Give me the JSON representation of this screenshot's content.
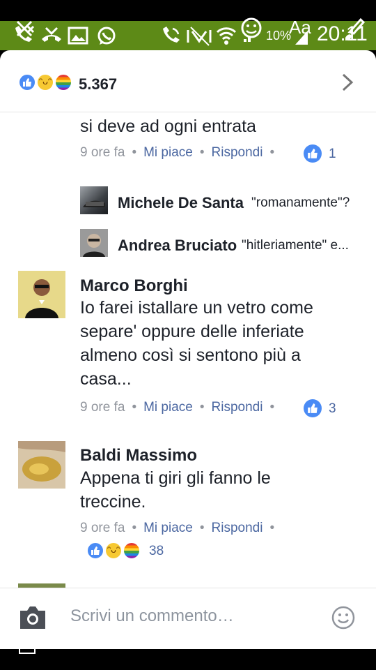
{
  "status_bar": {
    "time": "20:11",
    "battery": "10%",
    "text_size": "Aa"
  },
  "reactions_header": {
    "total": "5.367"
  },
  "comments": [
    {
      "text_tail": "si deve ad ogni entrata",
      "time": "9 ore fa",
      "like": "Mi piace",
      "reply": "Rispondi",
      "likes": "1"
    }
  ],
  "replies": [
    {
      "author": "Michele De Santa",
      "text": "\"romanamente\"?"
    },
    {
      "author": "Andrea Bruciato",
      "text": "\"hitleriamente\" e..."
    }
  ],
  "comment_marco": {
    "author": "Marco Borghi",
    "lines": [
      "Io farei istallare un vetro come",
      "separe' oppure delle inferiate",
      "almeno così si sentono più a",
      "casa..."
    ],
    "time": "9 ore fa",
    "like": "Mi piace",
    "reply": "Rispondi",
    "likes": "3"
  },
  "comment_baldi": {
    "author": "Baldi Massimo",
    "lines": [
      "Appena ti giri gli fanno le",
      "treccine."
    ],
    "time": "9 ore fa",
    "like": "Mi piace",
    "reply": "Rispondi",
    "reactions": "38"
  },
  "composer": {
    "placeholder": "Scrivi un commento…"
  },
  "colors": {
    "status_bar": "#5d8a17",
    "link": "#4b67a1",
    "like_blue": "#4a8bf5"
  }
}
